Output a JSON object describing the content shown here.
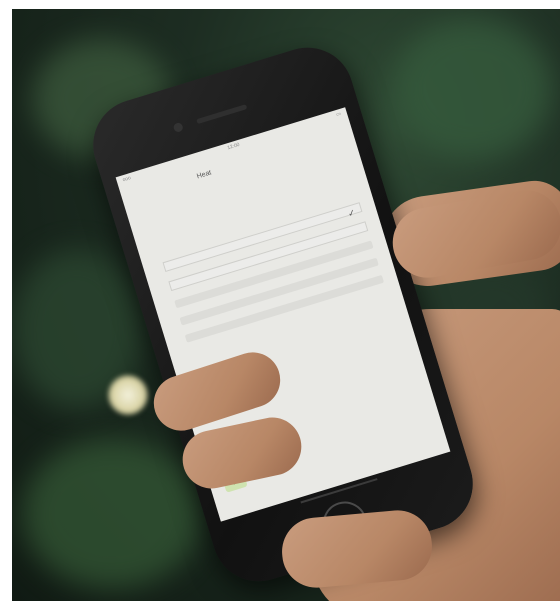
{
  "screen": {
    "status_bar": {
      "carrier": "ooo",
      "time": "12:00",
      "battery": "▭"
    },
    "header": {
      "back": "",
      "tab_active": "Heat",
      "tab_other": ""
    },
    "section_label": "",
    "fields": [
      {
        "label": "",
        "style": "plain"
      },
      {
        "label": "",
        "style": "boxed",
        "checked": true
      },
      {
        "label": "",
        "style": "boxed"
      },
      {
        "label": "",
        "style": "shaded"
      },
      {
        "label": "",
        "style": "shaded"
      },
      {
        "label": "",
        "style": "shaded"
      }
    ],
    "ok_button": "✓",
    "footer_right": ""
  },
  "colors": {
    "ok_green": "#cfe3b0",
    "screen_bg": "#e9e9e5",
    "foliage": "#1d2d22"
  }
}
